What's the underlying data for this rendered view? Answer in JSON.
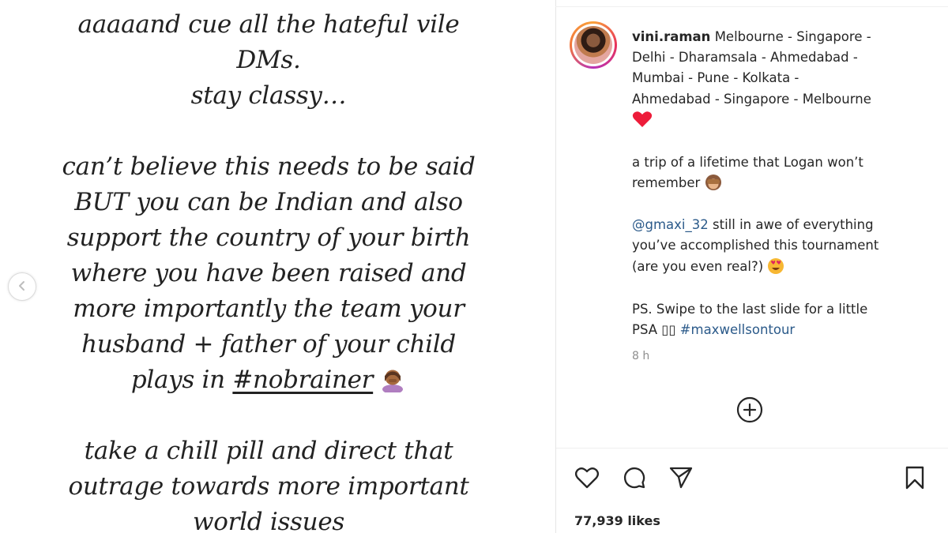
{
  "story": {
    "lines": [
      "aaaaand cue all the hateful vile",
      "DMs.",
      "stay classy…",
      "can’t believe this needs to be said",
      "BUT you can be Indian and also",
      "support the country of your birth",
      "where you have been raised and",
      "more importantly the team your",
      "husband + father of your child",
      "plays in",
      "take a chill pill and direct that",
      "outrage towards more important",
      "world issues"
    ],
    "hashtag": "#nobrainer"
  },
  "caption": {
    "username": "vini.raman",
    "location_line1": "Melbourne - Singapore -",
    "location_line2": "Delhi - Dharamsala - Ahmedabad -",
    "location_line3": "Mumbai - Pune - Kolkata -",
    "location_line4": "Ahmedabad - Singapore - Melbourne",
    "trip_line1": "a trip of a lifetime that Logan won’t",
    "trip_line2": "remember",
    "mention": "@gmaxi_32",
    "mention_rest": "still in awe of everything",
    "accomplished_line": "you’ve accomplished this tournament",
    "real_line": "(are you even real?)",
    "ps_line1": "PS. Swipe to the last slide for a little",
    "ps_line2_prefix": "PSA ▯▯",
    "ps_hashtag": "#maxwellsontour"
  },
  "timestamp": "8 h",
  "likes": "77,939 likes",
  "icons": {
    "prev": "chevron-left-icon",
    "load_more": "plus-circle-icon",
    "like": "heart-icon",
    "comment": "comment-icon",
    "share": "send-icon",
    "save": "bookmark-icon"
  },
  "colors": {
    "link": "#2b5a8a",
    "heart": "#ed1c3a",
    "text": "#262626",
    "muted": "#8e8e8e"
  }
}
